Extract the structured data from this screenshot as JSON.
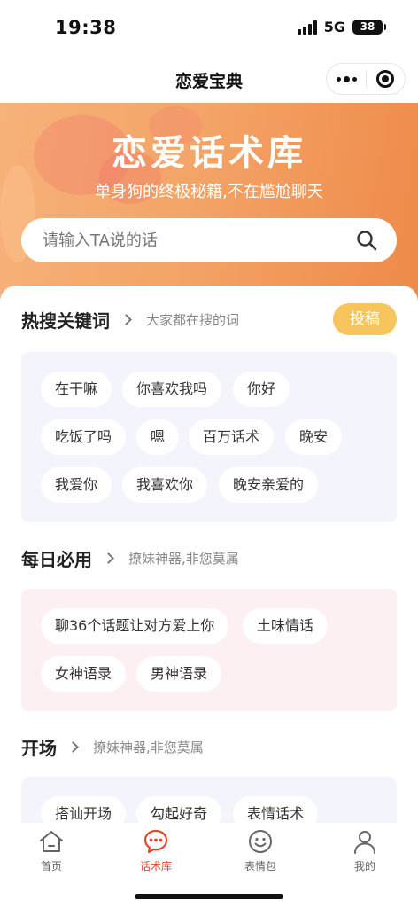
{
  "status_bar": {
    "time": "19:38",
    "network": "5G",
    "battery": "38"
  },
  "nav": {
    "title": "恋爱宝典"
  },
  "hero": {
    "title": "恋爱话术库",
    "subtitle": "单身狗的终极秘籍,不在尴尬聊天",
    "search_placeholder": "请输入TA说的话"
  },
  "hot_keywords": {
    "title": "热搜关键词",
    "desc": "大家都在搜的词",
    "contribute_label": "投稿",
    "chips": [
      "在干嘛",
      "你喜欢我吗",
      "你好",
      "吃饭了吗",
      "嗯",
      "百万话术",
      "晚安",
      "我爱你",
      "我喜欢你",
      "晚安亲爱的"
    ]
  },
  "daily": {
    "title": "每日必用",
    "desc": "撩妹神器,非您莫属",
    "chips": [
      "聊36个话题让对方爱上你",
      "土味情话",
      "女神语录",
      "男神语录"
    ]
  },
  "opening": {
    "title": "开场",
    "desc": "撩妹神器,非您莫属",
    "chips": [
      "搭讪开场",
      "勾起好奇",
      "表情话术"
    ]
  },
  "tabbar": {
    "items": [
      {
        "label": "首页",
        "icon": "home-icon",
        "active": false
      },
      {
        "label": "话术库",
        "icon": "chat-bubble-icon",
        "active": true
      },
      {
        "label": "表情包",
        "icon": "smiley-icon",
        "active": false
      },
      {
        "label": "我的",
        "icon": "person-icon",
        "active": false
      }
    ],
    "active_color": "#e5462f",
    "inactive_color": "#666666"
  },
  "colors": {
    "hero_start": "#f6b27a",
    "hero_end": "#ee8a49",
    "contribute": "#f6c55d",
    "panel_lavender": "#f4f4fc",
    "panel_pink": "#fcf0f2"
  }
}
